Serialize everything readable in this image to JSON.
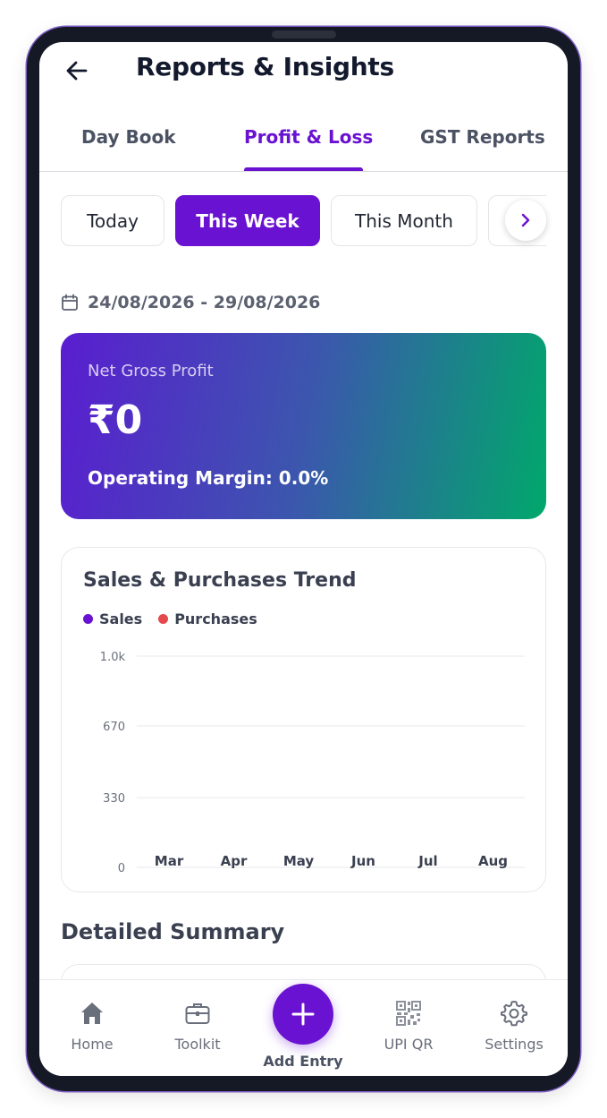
{
  "header": {
    "title": "Reports & Insights",
    "back_icon": "arrow-left-icon"
  },
  "tabs": [
    {
      "label": "Day Book",
      "active": false
    },
    {
      "label": "Profit & Loss",
      "active": true
    },
    {
      "label": "GST Reports",
      "active": false
    }
  ],
  "periods": [
    {
      "label": "Today",
      "active": false
    },
    {
      "label": "This Week",
      "active": true
    },
    {
      "label": "This Month",
      "active": false
    }
  ],
  "date_range": {
    "icon": "calendar-icon",
    "text": "24/08/2026 - 29/08/2026"
  },
  "profit_card": {
    "label": "Net Gross Profit",
    "value": "₹0",
    "margin": "Operating Margin: 0.0%"
  },
  "chart_data": {
    "type": "line",
    "title": "Sales & Purchases Trend",
    "categories": [
      "Mar",
      "Apr",
      "May",
      "Jun",
      "Jul",
      "Aug"
    ],
    "series": [
      {
        "name": "Sales",
        "color": "#6a12d1",
        "values": [
          0,
          0,
          0,
          0,
          0,
          0
        ]
      },
      {
        "name": "Purchases",
        "color": "#e5484d",
        "values": [
          0,
          0,
          0,
          0,
          0,
          0
        ]
      }
    ],
    "ytick_labels": [
      "0",
      "330",
      "670",
      "1.0k"
    ],
    "ytick_values": [
      0,
      330,
      670,
      1000
    ],
    "ylim": [
      0,
      1000
    ],
    "grid": true,
    "legend": "top-left"
  },
  "summary": {
    "title": "Detailed Summary"
  },
  "bottom_nav": {
    "items": [
      {
        "label": "Home",
        "icon": "home-icon"
      },
      {
        "label": "Toolkit",
        "icon": "toolkit-icon"
      },
      {
        "label": "UPI QR",
        "icon": "qr-code-icon"
      },
      {
        "label": "Settings",
        "icon": "gear-icon"
      }
    ],
    "add_label": "Add Entry"
  },
  "colors": {
    "accent": "#6a12d1",
    "purchases": "#e5484d",
    "gradient_start": "#5a1dd0",
    "gradient_end": "#00a86b"
  }
}
